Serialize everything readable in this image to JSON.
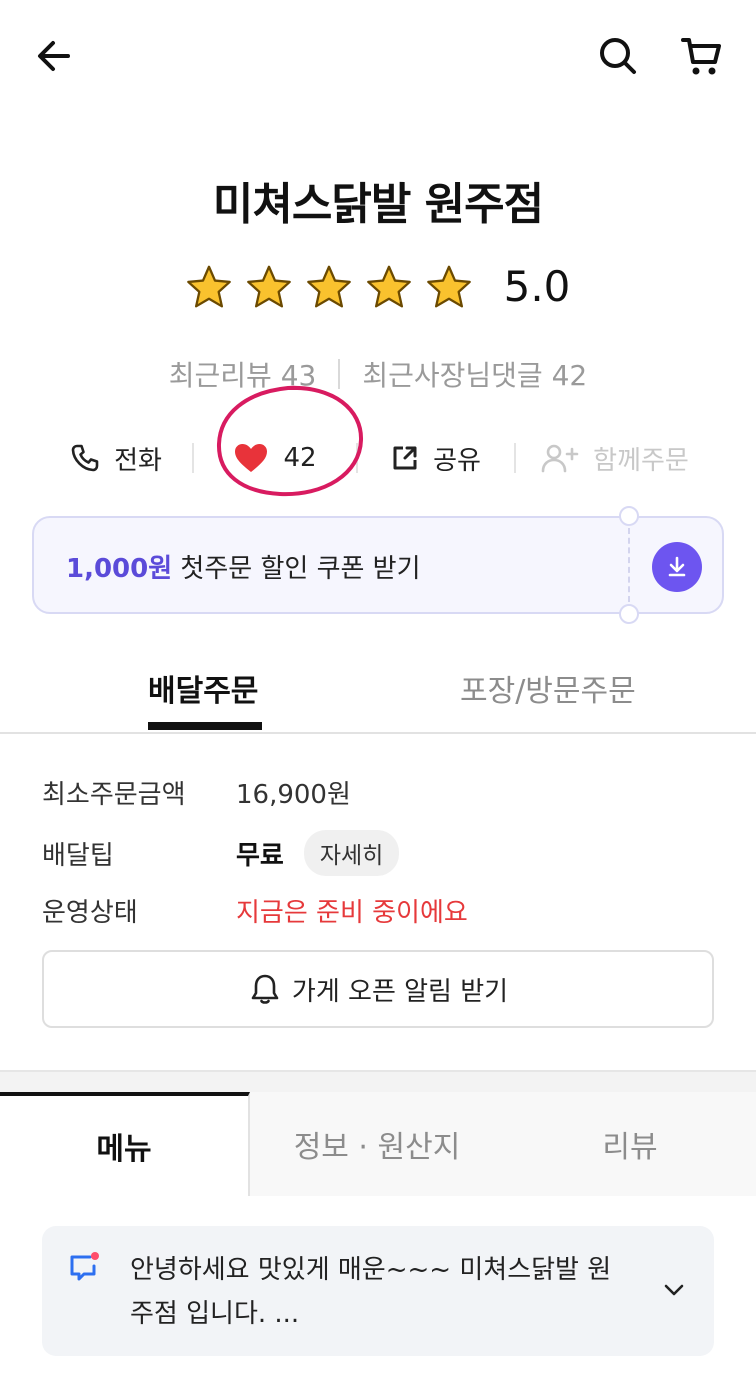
{
  "header": {
    "back_icon": "arrow-left-icon",
    "search_icon": "search-icon",
    "cart_icon": "cart-icon"
  },
  "store": {
    "name": "미쳐스닭발 원주점",
    "rating": "5.0",
    "stars_filled": 5,
    "stars_total": 5,
    "recent_reviews": "최근리뷰 43",
    "owner_replies": "최근사장님댓글 42"
  },
  "actions": {
    "call_label": "전화",
    "like_count": "42",
    "share_label": "공유",
    "group_order_label": "함께주문"
  },
  "coupon": {
    "amount": "1,000원",
    "text": " 첫주문 할인 쿠폰 받기",
    "download_icon": "download-icon"
  },
  "order_tabs": {
    "delivery": "배달주문",
    "pickup": "포장/방문주문"
  },
  "info": {
    "min_order_label": "최소주문금액",
    "min_order_value": "16,900원",
    "delivery_tip_label": "배달팁",
    "delivery_tip_value": "무료",
    "detail_label": "자세히",
    "status_label": "운영상태",
    "status_value": "지금은 준비 중이에요"
  },
  "alarm_button": "가게 오픈 알림 받기",
  "main_tabs": {
    "menu": "메뉴",
    "info": "정보 · 원산지",
    "reviews": "리뷰"
  },
  "notice": {
    "text": "안녕하세요 맛있게 매운~~~ 미쳐스닭발 원주점 입니다. ..."
  },
  "colors": {
    "accent": "#6d55f0",
    "coupon_text": "#5b4bd9",
    "status_red": "#e6393b",
    "heart_red": "#e8333a",
    "annotation_pink": "#d81b60"
  }
}
